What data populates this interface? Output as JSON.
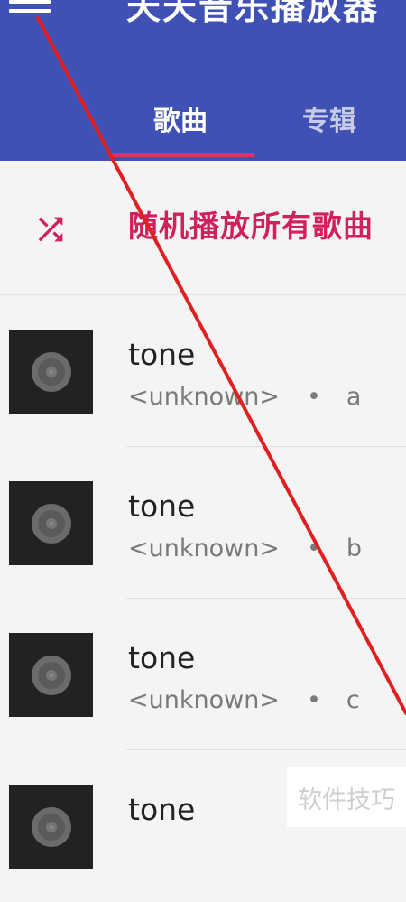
{
  "appbar": {
    "title": "天天音乐播放器",
    "menu_icon": "hamburger-menu-icon",
    "background": "#3f51b5"
  },
  "tabs": [
    {
      "label": "歌曲",
      "selected": true
    },
    {
      "label": "专辑",
      "selected": false
    }
  ],
  "accent": "#e8315a",
  "shuffle": {
    "icon": "shuffle-icon",
    "label": "随机播放所有歌曲",
    "color": "#d1205e"
  },
  "songs": [
    {
      "title": "tone",
      "artist": "<unknown>",
      "separator": "•",
      "album": "a",
      "art_icon": "vinyl-record-icon"
    },
    {
      "title": "tone",
      "artist": "<unknown>",
      "separator": "•",
      "album": "b",
      "art_icon": "vinyl-record-icon"
    },
    {
      "title": "tone",
      "artist": "<unknown>",
      "separator": "•",
      "album": "c",
      "art_icon": "vinyl-record-icon"
    },
    {
      "title": "tone",
      "artist": "",
      "separator": "",
      "album": "",
      "art_icon": "vinyl-record-icon"
    }
  ],
  "watermark": "软件技巧",
  "annotation_color": "#e02020"
}
